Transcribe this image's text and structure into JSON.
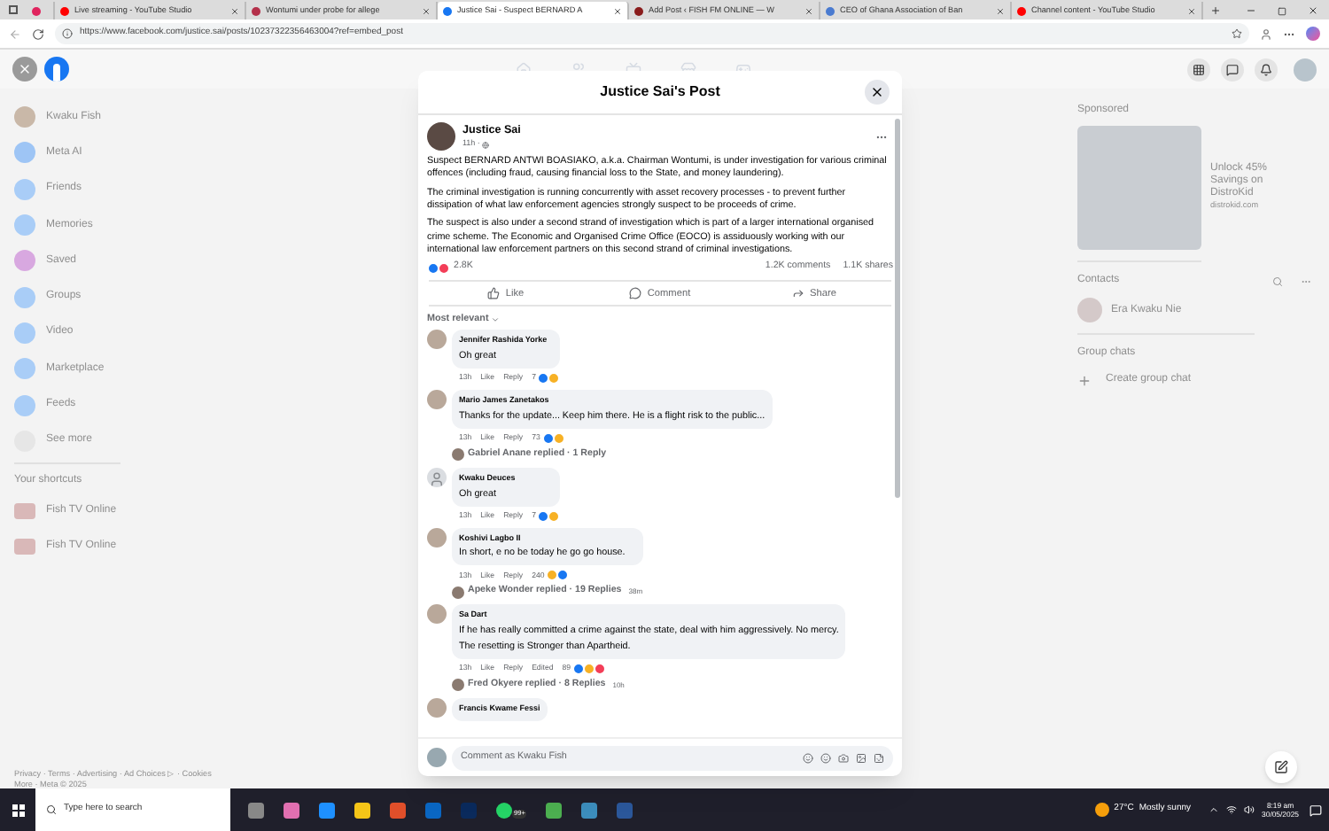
{
  "browser": {
    "tabs": [
      {
        "color": "#e0245e",
        "selected": false
      },
      {
        "title": "Live streaming - YouTube Studio",
        "color": "#ff0000",
        "selected": false
      },
      {
        "title": "Wontumi under probe for allege",
        "color": "#b4304a",
        "selected": false
      },
      {
        "title": "Justice Sai - Suspect BERNARD A",
        "color": "#1877f2",
        "selected": true
      },
      {
        "title": "Add Post ‹ FISH FM ONLINE — W",
        "color": "#8a1c1c",
        "selected": false
      },
      {
        "title": "CEO of Ghana Association of Ban",
        "color": "#4a7bd0",
        "selected": false
      },
      {
        "title": "Channel content - YouTube Studio",
        "color": "#ff0000",
        "selected": false
      }
    ],
    "url": "https://www.facebook.com/justice.sai/posts/10237322356463004?ref=embed_post"
  },
  "left_nav": {
    "items": [
      {
        "label": "Kwaku Fish",
        "kind": "profile"
      },
      {
        "label": "Meta AI",
        "kind": "ai"
      },
      {
        "label": "Friends",
        "kind": "friends"
      },
      {
        "label": "Memories",
        "kind": "memories"
      },
      {
        "label": "Saved",
        "kind": "saved"
      },
      {
        "label": "Groups",
        "kind": "groups"
      },
      {
        "label": "Video",
        "kind": "video"
      },
      {
        "label": "Marketplace",
        "kind": "marketplace"
      },
      {
        "label": "Feeds",
        "kind": "feeds"
      },
      {
        "label": "See more",
        "kind": "more"
      }
    ],
    "shortcuts_heading": "Your shortcuts",
    "shortcuts": [
      "Fish TV Online",
      "Fish TV Online"
    ],
    "footer": [
      "Privacy · Terms · Advertising · Ad Choices ▷ · Cookies",
      "More · Meta © 2025"
    ]
  },
  "modal": {
    "title": "Justice Sai's Post",
    "post": {
      "author": "Justice Sai",
      "time": "11h ·",
      "paragraphs": [
        "Suspect BERNARD ANTWI BOASIAKO, a.k.a. Chairman Wontumi, is under investigation for various criminal offences (including fraud, causing financial loss to the State, and money laundering).",
        "The criminal investigation is running concurrently with asset recovery processes - to prevent further dissipation of what law enforcement agencies strongly suspect to be proceeds of crime.",
        "The suspect is also under a second strand of investigation which is part of a larger international organised crime scheme. The Economic and Organised Crime Office (EOCO) is assiduously working with our international law enforcement partners on this second strand of criminal investigations."
      ],
      "reactions": [
        {
          "kind": "like"
        },
        {
          "kind": "love"
        }
      ],
      "reaction_count": "2.8K",
      "comments_count": "1.2K comments",
      "shares_count": "1.1K shares"
    },
    "actions": [
      {
        "label": "Like",
        "kind": "like"
      },
      {
        "label": "Comment",
        "kind": "comment"
      },
      {
        "label": "Share",
        "kind": "share"
      }
    ],
    "sort_label": "Most relevant",
    "comments": [
      {
        "author": "Jennifer Rashida Yorke",
        "texts": [
          "Oh great"
        ],
        "time": "13h",
        "like": "Like",
        "reply": "Reply",
        "count": "7",
        "reactions": [
          {
            "kind": "like"
          },
          {
            "kind": "haha"
          }
        ]
      },
      {
        "author": "Mario James Zanetakos",
        "texts": [
          "Thanks for the update... Keep him there. He is a flight risk to the public..."
        ],
        "time": "13h",
        "like": "Like",
        "reply": "Reply",
        "count": "73",
        "reactions": [
          {
            "kind": "like"
          },
          {
            "kind": "haha"
          }
        ],
        "replies": {
          "text": "Gabriel Anane replied · 1 Reply"
        }
      },
      {
        "author": "Kwaku Deuces",
        "texts": [
          "Oh great"
        ],
        "time": "13h",
        "like": "Like",
        "reply": "Reply",
        "count": "7",
        "reactions": [
          {
            "kind": "like"
          },
          {
            "kind": "care"
          }
        ],
        "generic_avatar": true
      },
      {
        "author": "Koshivi Lagbo II",
        "texts": [
          "In short, e no be today he go go house."
        ],
        "time": "13h",
        "like": "Like",
        "reply": "Reply",
        "count": "240",
        "reactions": [
          {
            "kind": "haha"
          },
          {
            "kind": "like"
          }
        ],
        "replies": {
          "text": "Apeke Wonder replied · 19 Replies",
          "time": "38m"
        }
      },
      {
        "author": "Sa Dart",
        "texts": [
          "If he has really committed a crime against the state, deal with him aggressively. No mercy.",
          "The resetting is Stronger than Apartheid."
        ],
        "time": "13h",
        "like": "Like",
        "reply": "Reply",
        "edited": "Edited",
        "count": "89",
        "reactions": [
          {
            "kind": "like"
          },
          {
            "kind": "haha"
          },
          {
            "kind": "love"
          }
        ],
        "replies": {
          "text": "Fred Okyere replied · 8 Replies",
          "time": "10h"
        }
      },
      {
        "author": "Francis Kwame Fessi"
      }
    ],
    "comment_placeholder": "Comment as Kwaku Fish"
  },
  "right": {
    "sponsored_heading": "Sponsored",
    "ad_title": "Unlock 45% Savings on DistroKid",
    "ad_domain": "distrokid.com",
    "contacts_heading": "Contacts",
    "contacts": [
      "Era Kwaku Nie"
    ],
    "group_chats_heading": "Group chats",
    "create_group_chat": "Create group chat"
  },
  "taskbar": {
    "search_placeholder": "Type here to search",
    "badge": "99+",
    "temperature": "27°C",
    "weather": "Mostly sunny",
    "time": "8:19 am",
    "date": "30/05/2025"
  }
}
